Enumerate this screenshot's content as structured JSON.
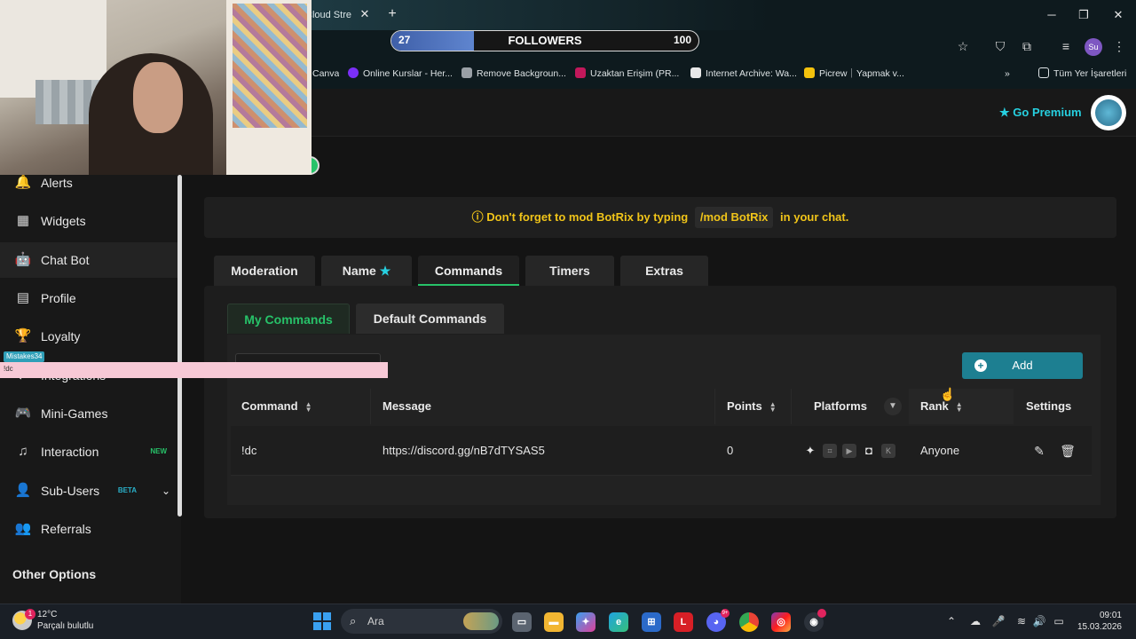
{
  "browser": {
    "tab_title": "Cloud Stre",
    "tab_close": "✕",
    "new_tab": "+",
    "followers_widget": {
      "current": "27",
      "label": "FOLLOWERS",
      "goal": "100",
      "progress_fraction": 0.27
    },
    "bookmarks": [
      {
        "label": "Canva",
        "color": "#00c4cc"
      },
      {
        "label": "Online Kurslar - Her...",
        "color": "#7b2ff7"
      },
      {
        "label": "Remove Backgroun...",
        "color": "#9aa0a6"
      },
      {
        "label": "Uzaktan Erişim (PR...",
        "color": "#c2185b"
      },
      {
        "label": "Internet Archive: Wa...",
        "color": "#e8e8e8"
      },
      {
        "label": "Picrew｜Yapmak v...",
        "color": "#f4c20d"
      }
    ],
    "bookmarks_overflow": "»",
    "all_bookmarks": "Tüm Yer İşaretleri",
    "profile_initials": "Su"
  },
  "header": {
    "premium_label": "Go Premium"
  },
  "sidebar": {
    "items": [
      {
        "label": "Alerts",
        "icon": "🔔",
        "tag": ""
      },
      {
        "label": "Widgets",
        "icon": "▦",
        "tag": ""
      },
      {
        "label": "Chat Bot",
        "icon": "🤖",
        "tag": ""
      },
      {
        "label": "Profile",
        "icon": "▤",
        "tag": ""
      },
      {
        "label": "Loyalty",
        "icon": "🏆",
        "tag": ""
      },
      {
        "label": "Integrations",
        "icon": "⇄",
        "tag": ""
      },
      {
        "label": "Mini-Games",
        "icon": "🎮",
        "tag": ""
      },
      {
        "label": "Interaction",
        "icon": "♫",
        "tag": "NEW"
      },
      {
        "label": "Sub-Users",
        "icon": "👤",
        "tag": "BETA"
      },
      {
        "label": "Referrals",
        "icon": "👥",
        "tag": ""
      }
    ],
    "other_options": "Other Options"
  },
  "notice": {
    "before": "Don't forget to mod BotRix by typing",
    "code": "/mod BotRix",
    "after": "in your chat."
  },
  "tabs": [
    "Moderation",
    "Name",
    "Commands",
    "Timers",
    "Extras"
  ],
  "subtabs": [
    "My Commands",
    "Default Commands"
  ],
  "add_button": "Add",
  "table": {
    "columns": [
      "Command",
      "Message",
      "Points",
      "Platforms",
      "Rank",
      "Settings"
    ],
    "rows": [
      {
        "command": "!dc",
        "message": "https://discord.gg/nB7dTYSAS5",
        "points": "0",
        "rank": "Anyone"
      }
    ]
  },
  "stream_overlay": {
    "chat_user": "Mistakes34",
    "chat_text": "!dc"
  },
  "taskbar": {
    "weather_temp": "12°C",
    "weather_desc": "Parçalı bulutlu",
    "weather_badge": "1",
    "search_placeholder": "Ara",
    "time": "09:01",
    "date": "15.03.2026"
  },
  "colors": {
    "accent_green": "#27c269",
    "accent_teal": "#27d0e0",
    "warning_yellow": "#f0c419",
    "add_button": "#1d7f91"
  }
}
